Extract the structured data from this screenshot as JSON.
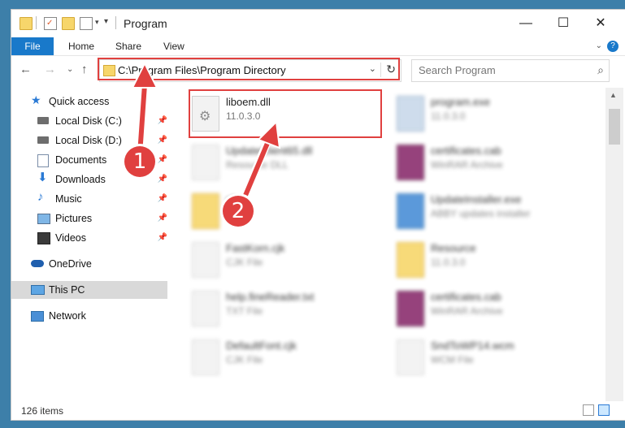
{
  "window": {
    "title": "Program",
    "minimize": "—",
    "maximize": "☐",
    "close": "✕"
  },
  "ribbon": {
    "tabs": [
      "File",
      "Home",
      "Share",
      "View"
    ],
    "help": "?"
  },
  "address": {
    "path": "C:\\Program Files\\Program Directory",
    "search_placeholder": "Search Program"
  },
  "sidebar": {
    "items": [
      {
        "label": "Quick access",
        "icon": "star-icon"
      },
      {
        "label": "Local Disk (C:)",
        "icon": "drive-icon",
        "pinned": true
      },
      {
        "label": "Local Disk (D:)",
        "icon": "drive-icon",
        "pinned": true
      },
      {
        "label": "Documents",
        "icon": "documents-icon",
        "pinned": true
      },
      {
        "label": "Downloads",
        "icon": "downloads-icon",
        "pinned": true
      },
      {
        "label": "Music",
        "icon": "music-icon",
        "pinned": true
      },
      {
        "label": "Pictures",
        "icon": "pictures-icon",
        "pinned": true
      },
      {
        "label": "Videos",
        "icon": "videos-icon",
        "pinned": true
      },
      {
        "label": "OneDrive",
        "icon": "cloud-icon"
      },
      {
        "label": "This PC",
        "icon": "computer-icon"
      },
      {
        "label": "Network",
        "icon": "network-icon"
      }
    ]
  },
  "files": [
    {
      "name": "liboem.dll",
      "sub": "11.0.3.0"
    },
    {
      "name": "program.exe",
      "sub": "11.0.3.0"
    },
    {
      "name": "UpdateClient65.dll",
      "sub": "Resource DLL"
    },
    {
      "name": "certificates.cab",
      "sub": "WinRAR Archive"
    },
    {
      "name": "cfg",
      "sub": ""
    },
    {
      "name": "UpdateInstaller.exe",
      "sub": "ABBY updates installer"
    },
    {
      "name": "FastKorn.cjk",
      "sub": "CJK File"
    },
    {
      "name": "Resource",
      "sub": "11.0.3.0"
    },
    {
      "name": "help.fineReader.txt",
      "sub": "TXT File"
    },
    {
      "name": "certificates.cab",
      "sub": "WinRAR Archive"
    },
    {
      "name": "DefaultFont.cjk",
      "sub": "CJK File"
    },
    {
      "name": "SndToWP14.wcm",
      "sub": "WCM File"
    }
  ],
  "status": {
    "count": "126 items"
  },
  "annotations": {
    "badge1": "1",
    "badge2": "2",
    "color": "#e0403f"
  }
}
